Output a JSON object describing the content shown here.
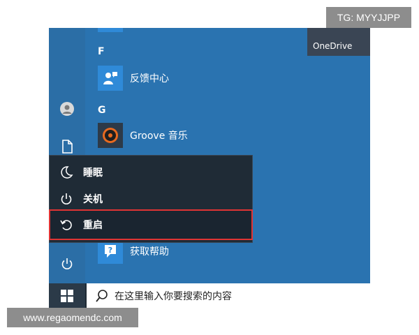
{
  "watermarks": {
    "top": "TG: MYYJJPP",
    "bottom": "www.regaomendc.com"
  },
  "start_menu": {
    "tiles": {
      "onedrive": "OneDrive"
    },
    "app_list": {
      "section_f": "F",
      "section_g": "G",
      "feedback_hub": "反馈中心",
      "groove_music": "Groove 音乐",
      "get_help": "获取帮助"
    },
    "power_menu": {
      "sleep": "睡眠",
      "shutdown": "关机",
      "restart": "重启"
    }
  },
  "taskbar": {
    "search_placeholder": "在这里输入你要搜索的内容"
  },
  "icons": {
    "user": "user-icon",
    "document": "document-icon",
    "power": "power-icon",
    "windows": "windows-logo-icon",
    "search": "search-icon",
    "sleep": "moon-icon",
    "shutdown": "power-icon",
    "restart": "restart-icon",
    "feedback": "feedback-hub-icon",
    "groove": "groove-music-icon",
    "help": "help-icon"
  },
  "colors": {
    "accent": "#2a73b0",
    "flyout": "#1f2b36",
    "highlight_border": "#e03434"
  }
}
